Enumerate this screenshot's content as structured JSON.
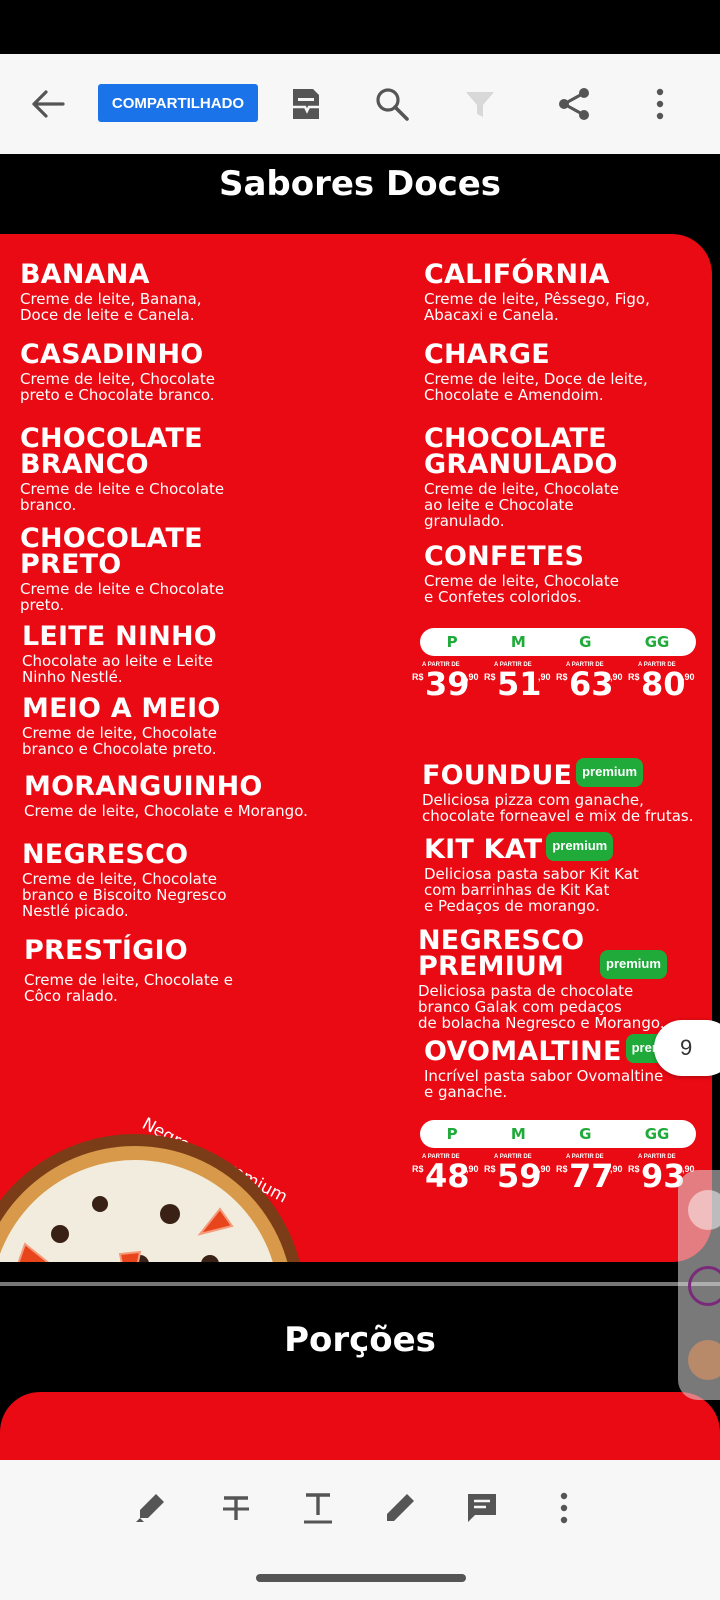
{
  "toolbar": {
    "shared_label": "COMPARTILHADO",
    "icons": [
      "back-arrow-icon",
      "page-layout-icon",
      "search-icon",
      "filter-icon",
      "share-icon",
      "more-vertical-icon"
    ]
  },
  "sections": {
    "sweet_title": "Sabores Doces",
    "portions_title": "Porções"
  },
  "left_items": [
    {
      "name": "BANANA",
      "desc": "Creme de leite, Banana,\nDoce de leite e Canela."
    },
    {
      "name": "CASADINHO",
      "desc": "Creme de leite, Chocolate\npreto e Chocolate branco."
    },
    {
      "name": "CHOCOLATE\nBRANCO",
      "desc": "Creme de leite e Chocolate\nbranco."
    },
    {
      "name": "CHOCOLATE\nPRETO",
      "desc": "Creme de leite e Chocolate\npreto."
    },
    {
      "name": "LEITE NINHO",
      "desc": "Chocolate ao leite e Leite\nNinho Nestlé."
    },
    {
      "name": "MEIO A MEIO",
      "desc": "Creme de leite, Chocolate\nbranco e Chocolate preto."
    },
    {
      "name": "MORANGUINHO",
      "desc": "Creme de leite, Chocolate e Morango."
    },
    {
      "name": "NEGRESCO",
      "desc": "Creme de leite, Chocolate\nbranco e Biscoito Negresco\nNestlé picado."
    },
    {
      "name": "PRESTÍGIO",
      "desc": "Creme de leite, Chocolate e\nCôco ralado."
    }
  ],
  "right_items": [
    {
      "name": "CALIFÓRNIA",
      "desc": "Creme de leite, Pêssego, Figo,\nAbacaxi e Canela."
    },
    {
      "name": "CHARGE",
      "desc": "Creme de leite, Doce de leite,\nChocolate e Amendoim."
    },
    {
      "name": "CHOCOLATE\nGRANULADO",
      "desc": "Creme de leite, Chocolate\nao leite e Chocolate\ngranulado."
    },
    {
      "name": "CONFETES",
      "desc": "Creme de leite, Chocolate\ne Confetes coloridos."
    }
  ],
  "premium_items": [
    {
      "name": "FOUNDUE",
      "badge": "premium",
      "desc": "Deliciosa pizza com ganache,\nchocolate forneavel e mix de frutas."
    },
    {
      "name": "KIT KAT",
      "badge": "premium",
      "desc": "Deliciosa pasta sabor Kit Kat\ncom barrinhas de Kit Kat\ne Pedaços de morango."
    },
    {
      "name": "NEGRESCO\nPREMIUM",
      "badge": "premium",
      "desc": "Deliciosa pasta de chocolate\nbranco Galak com pedaços\nde bolacha Negresco e Morango."
    },
    {
      "name": "OVOMALTINE",
      "badge": "premium",
      "desc": "Incrível pasta sabor Ovomaltine\ne ganache."
    }
  ],
  "sizes": [
    "P",
    "M",
    "G",
    "GG"
  ],
  "price_prefix": "A PARTIR DE",
  "currency": "R$",
  "prices_regular": [
    {
      "int": "39",
      "dec": ",90"
    },
    {
      "int": "51",
      "dec": ",90"
    },
    {
      "int": "63",
      "dec": ",90"
    },
    {
      "int": "80",
      "dec": ",90"
    }
  ],
  "prices_premium": [
    {
      "int": "48",
      "dec": ",90"
    },
    {
      "int": "59",
      "dec": ",90"
    },
    {
      "int": "77",
      "dec": ",90"
    },
    {
      "int": "93",
      "dec": ",90"
    }
  ],
  "pizza_caption": "Negresco premium",
  "page_number": "9",
  "bottom_tools": [
    "highlighter-icon",
    "strikethrough-icon",
    "text-icon",
    "pen-icon",
    "comment-icon",
    "more-vertical-icon"
  ],
  "colors": {
    "menu_red": "#ea0a13",
    "premium_green": "#1faa3a",
    "shared_blue": "#1a73e8"
  }
}
